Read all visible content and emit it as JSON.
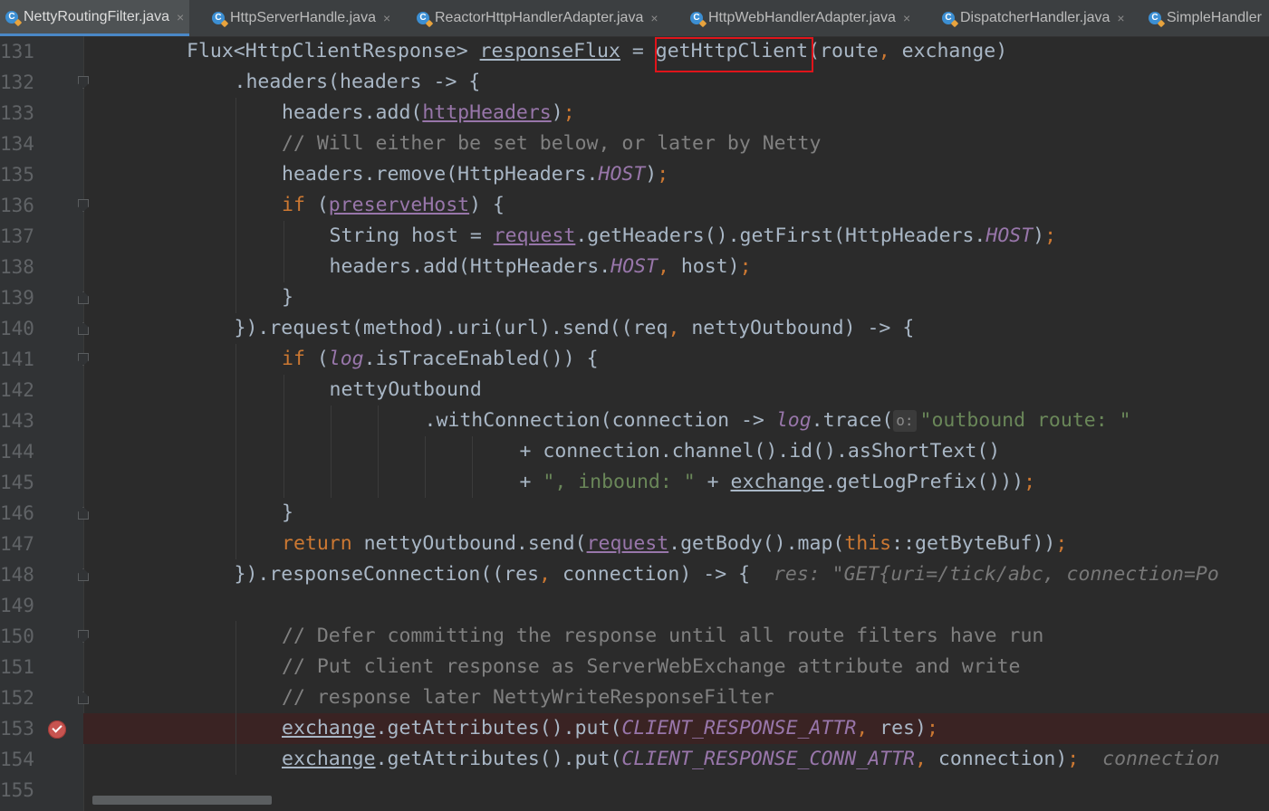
{
  "tabs": [
    {
      "label": "NettyRoutingFilter.java",
      "active": true
    },
    {
      "label": "HttpServerHandle.java",
      "active": false
    },
    {
      "label": "ReactorHttpHandlerAdapter.java",
      "active": false
    },
    {
      "label": "HttpWebHandlerAdapter.java",
      "active": false
    },
    {
      "label": "DispatcherHandler.java",
      "active": false
    },
    {
      "label": "SimpleHandler",
      "active": false
    }
  ],
  "tab_icon_letter": "C",
  "tab_close_glyph": "×",
  "hint_chip": "o:",
  "lines": [
    {
      "n": "131",
      "indent": 0,
      "fold": "",
      "tokens": [
        [
          "p",
          "Flux<HttpClientResponse> "
        ],
        [
          "ul",
          "responseFlux"
        ],
        [
          "p",
          " = "
        ],
        [
          "p",
          "getHttpClient"
        ],
        [
          "p",
          "(route"
        ],
        [
          "k",
          ", "
        ],
        [
          "p",
          "exchange)"
        ]
      ]
    },
    {
      "n": "132",
      "indent": 1,
      "fold": "open",
      "tokens": [
        [
          "p",
          ".headers(headers -> {"
        ]
      ]
    },
    {
      "n": "133",
      "indent": 2,
      "fold": "",
      "tokens": [
        [
          "p",
          "headers.add("
        ],
        [
          "ulp",
          "httpHeaders"
        ],
        [
          "p",
          ")"
        ],
        [
          "k",
          ";"
        ]
      ]
    },
    {
      "n": "134",
      "indent": 2,
      "fold": "",
      "tokens": [
        [
          "c",
          "// Will either be set below, or later by Netty"
        ]
      ]
    },
    {
      "n": "135",
      "indent": 2,
      "fold": "",
      "tokens": [
        [
          "p",
          "headers.remove(HttpHeaders."
        ],
        [
          "s",
          "HOST"
        ],
        [
          "p",
          ")"
        ],
        [
          "k",
          ";"
        ]
      ]
    },
    {
      "n": "136",
      "indent": 2,
      "fold": "open",
      "tokens": [
        [
          "k",
          "if "
        ],
        [
          "p",
          "("
        ],
        [
          "ulp",
          "preserveHost"
        ],
        [
          "p",
          ") {"
        ]
      ]
    },
    {
      "n": "137",
      "indent": 3,
      "fold": "",
      "tokens": [
        [
          "p",
          "String host = "
        ],
        [
          "ulp",
          "request"
        ],
        [
          "p",
          ".getHeaders().getFirst(HttpHeaders."
        ],
        [
          "s",
          "HOST"
        ],
        [
          "p",
          ")"
        ],
        [
          "k",
          ";"
        ]
      ]
    },
    {
      "n": "138",
      "indent": 3,
      "fold": "",
      "tokens": [
        [
          "p",
          "headers.add(HttpHeaders."
        ],
        [
          "s",
          "HOST"
        ],
        [
          "k",
          ", "
        ],
        [
          "p",
          "host)"
        ],
        [
          "k",
          ";"
        ]
      ]
    },
    {
      "n": "139",
      "indent": 2,
      "fold": "close",
      "tokens": [
        [
          "p",
          "}"
        ]
      ]
    },
    {
      "n": "140",
      "indent": 1,
      "fold": "close",
      "tokens": [
        [
          "p",
          "}).request(method).uri(url).send((req"
        ],
        [
          "k",
          ", "
        ],
        [
          "p",
          "nettyOutbound) -> {"
        ]
      ]
    },
    {
      "n": "141",
      "indent": 2,
      "fold": "open",
      "tokens": [
        [
          "k",
          "if "
        ],
        [
          "p",
          "("
        ],
        [
          "s",
          "log"
        ],
        [
          "p",
          ".isTraceEnabled()) {"
        ]
      ]
    },
    {
      "n": "142",
      "indent": 3,
      "fold": "",
      "tokens": [
        [
          "p",
          "nettyOutbound"
        ]
      ]
    },
    {
      "n": "143",
      "indent": 5,
      "fold": "",
      "tokens": [
        [
          "p",
          ".withConnection(connection -> "
        ],
        [
          "s",
          "log"
        ],
        [
          "p",
          ".trace("
        ],
        [
          "chip",
          "o:"
        ],
        [
          "str",
          "\"outbound route: \""
        ]
      ]
    },
    {
      "n": "144",
      "indent": 7,
      "fold": "",
      "tokens": [
        [
          "p",
          "+ connection.channel().id().asShortText()"
        ]
      ]
    },
    {
      "n": "145",
      "indent": 7,
      "fold": "",
      "tokens": [
        [
          "p",
          "+ "
        ],
        [
          "str",
          "\", inbound: \""
        ],
        [
          "p",
          " + "
        ],
        [
          "ul",
          "exchange"
        ],
        [
          "p",
          ".getLogPrefix()))"
        ],
        [
          "k",
          ";"
        ]
      ]
    },
    {
      "n": "146",
      "indent": 2,
      "fold": "close",
      "tokens": [
        [
          "p",
          "}"
        ]
      ]
    },
    {
      "n": "147",
      "indent": 2,
      "fold": "",
      "tokens": [
        [
          "k",
          "return "
        ],
        [
          "p",
          "nettyOutbound.send("
        ],
        [
          "ulp",
          "request"
        ],
        [
          "p",
          ".getBody().map("
        ],
        [
          "k",
          "this"
        ],
        [
          "p",
          "::getByteBuf))"
        ],
        [
          "k",
          ";"
        ]
      ]
    },
    {
      "n": "148",
      "indent": 1,
      "fold": "close",
      "tokens": [
        [
          "p",
          "}).responseConnection((res"
        ],
        [
          "k",
          ", "
        ],
        [
          "p",
          "connection) -> {  "
        ],
        [
          "h",
          "res: \"GET{uri=/tick/abc, connection=Po"
        ]
      ]
    },
    {
      "n": "149",
      "indent": 0,
      "fold": "",
      "tokens": []
    },
    {
      "n": "150",
      "indent": 2,
      "fold": "open",
      "tokens": [
        [
          "c",
          "// Defer committing the response until all route filters have run"
        ]
      ]
    },
    {
      "n": "151",
      "indent": 2,
      "fold": "",
      "tokens": [
        [
          "c",
          "// Put client response as ServerWebExchange attribute and write"
        ]
      ]
    },
    {
      "n": "152",
      "indent": 2,
      "fold": "close",
      "tokens": [
        [
          "c",
          "// response later NettyWriteResponseFilter"
        ]
      ]
    },
    {
      "n": "153",
      "indent": 2,
      "fold": "",
      "bp": true,
      "tokens": [
        [
          "ul",
          "exchange"
        ],
        [
          "p",
          ".getAttributes().put("
        ],
        [
          "s",
          "CLIENT_RESPONSE_ATTR"
        ],
        [
          "k",
          ", "
        ],
        [
          "p",
          "res)"
        ],
        [
          "k",
          ";"
        ]
      ]
    },
    {
      "n": "154",
      "indent": 2,
      "fold": "",
      "tokens": [
        [
          "ul",
          "exchange"
        ],
        [
          "p",
          ".getAttributes().put("
        ],
        [
          "s",
          "CLIENT_RESPONSE_CONN_ATTR"
        ],
        [
          "k",
          ", "
        ],
        [
          "p",
          "connection)"
        ],
        [
          "k",
          ";"
        ],
        [
          "p",
          "  "
        ],
        [
          "h",
          "connection"
        ]
      ]
    },
    {
      "n": "155",
      "indent": 0,
      "fold": "",
      "tokens": []
    }
  ],
  "colors": {
    "background": "#2b2b2b",
    "keyword": "#cc7832",
    "string": "#6a8759",
    "comment": "#808080",
    "field": "#9876aa",
    "plain": "#a9b7c6",
    "highlight_box": "#e0141a",
    "breakpoint": "#c75450"
  }
}
